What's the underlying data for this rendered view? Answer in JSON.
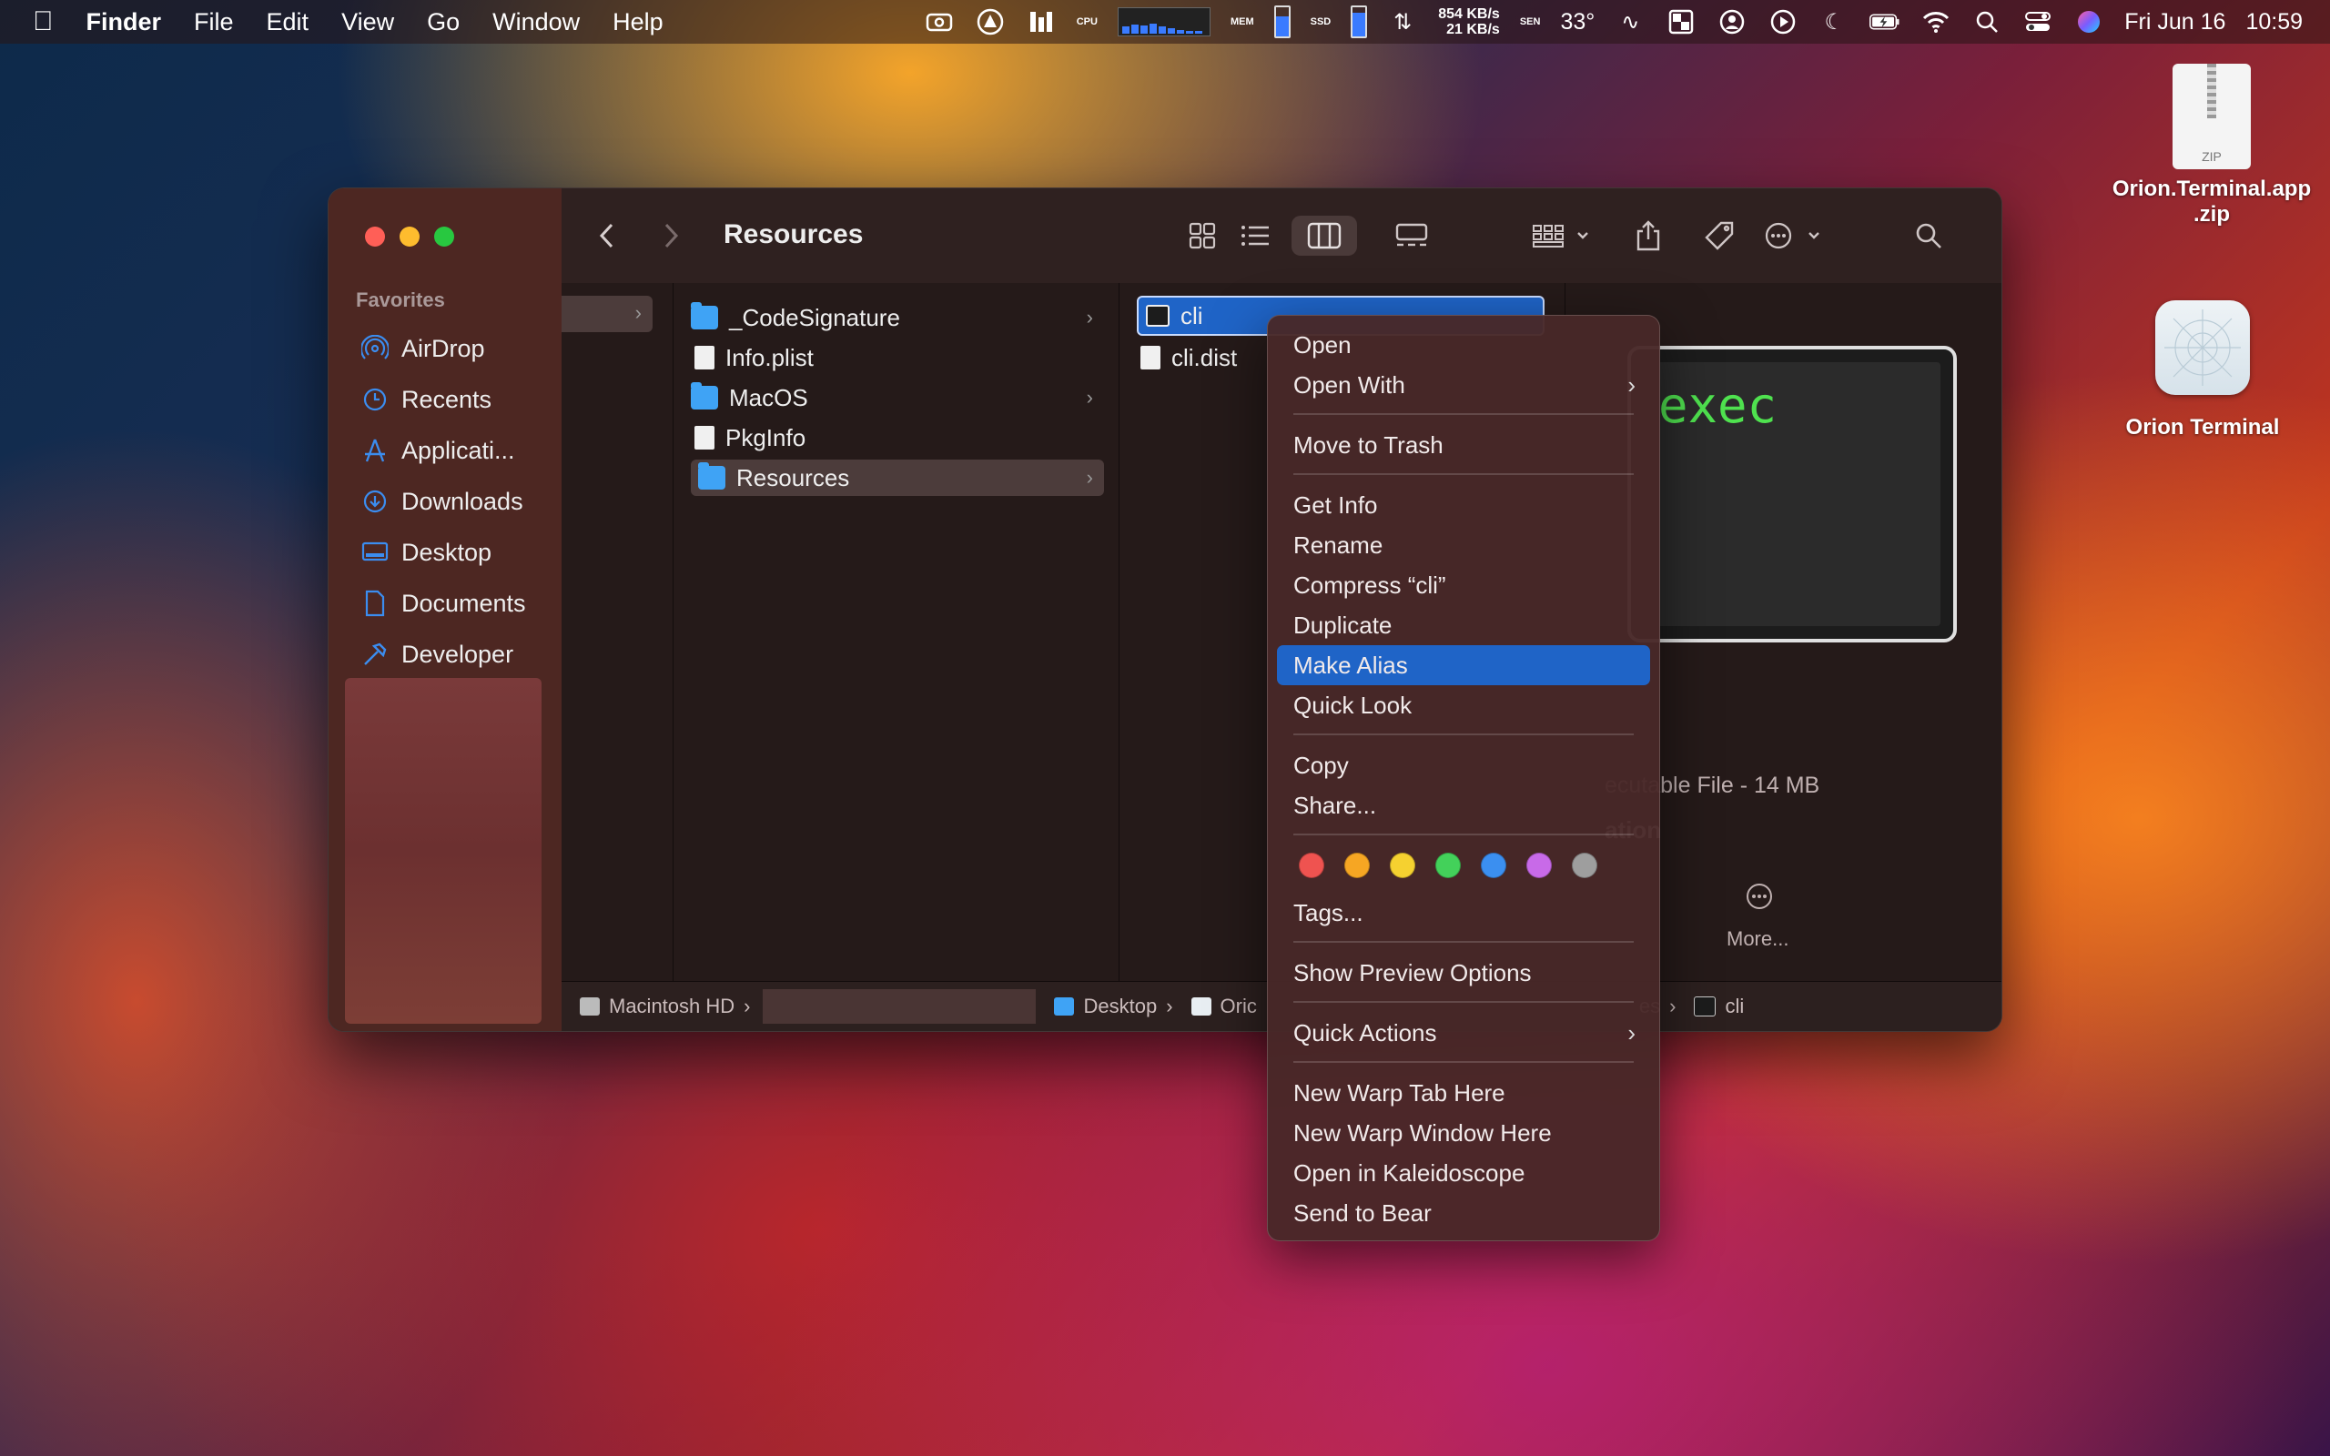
{
  "menubar": {
    "apple": "",
    "app": "Finder",
    "items": [
      "File",
      "Edit",
      "View",
      "Go",
      "Window",
      "Help"
    ],
    "net_up": "854 KB/s",
    "net_down": "21 KB/s",
    "temp": "33°",
    "cpu_label": "CPU",
    "mem_label": "MEM",
    "ssd_label": "SSD",
    "sen_label": "SEN",
    "date": "Fri Jun 16",
    "time": "10:59"
  },
  "sidebar": {
    "heading": "Favorites",
    "items": [
      {
        "label": "AirDrop",
        "icon": "airdrop-icon"
      },
      {
        "label": "Recents",
        "icon": "clock-icon"
      },
      {
        "label": "Applicati...",
        "icon": "applications-icon"
      },
      {
        "label": "Downloads",
        "icon": "download-icon"
      },
      {
        "label": "Desktop",
        "icon": "desktop-icon"
      },
      {
        "label": "Documents",
        "icon": "document-icon"
      },
      {
        "label": "Developer",
        "icon": "hammer-icon"
      }
    ]
  },
  "toolbar": {
    "title": "Resources"
  },
  "column2": [
    {
      "label": "_CodeSignature",
      "type": "folder",
      "chevron": true
    },
    {
      "label": "Info.plist",
      "type": "file",
      "chevron": false
    },
    {
      "label": "MacOS",
      "type": "folder",
      "chevron": true
    },
    {
      "label": "PkgInfo",
      "type": "file",
      "chevron": false
    },
    {
      "label": "Resources",
      "type": "folder",
      "chevron": true,
      "selected": true
    }
  ],
  "column3": [
    {
      "label": "cli",
      "type": "exec",
      "selected": true
    },
    {
      "label": "cli.dist",
      "type": "file"
    }
  ],
  "preview": {
    "screen_text": "exec",
    "kind": "ecutable File - 14 MB",
    "info": "ation",
    "more": "More..."
  },
  "pathbar": {
    "items": [
      "Macintosh HD",
      "Desktop",
      "Oric",
      "es",
      "cli"
    ]
  },
  "context_menu": {
    "open": "Open",
    "open_with": "Open With",
    "move_to_trash": "Move to Trash",
    "get_info": "Get Info",
    "rename": "Rename",
    "compress": "Compress “cli”",
    "duplicate": "Duplicate",
    "make_alias": "Make Alias",
    "quick_look": "Quick Look",
    "copy": "Copy",
    "share": "Share...",
    "tags": "Tags...",
    "show_preview_options": "Show Preview Options",
    "quick_actions": "Quick Actions",
    "new_warp_tab": "New Warp Tab Here",
    "new_warp_window": "New Warp Window Here",
    "open_kaleidoscope": "Open in Kaleidoscope",
    "send_to_bear": "Send to Bear",
    "tag_colors": [
      "#ef5350",
      "#f6a623",
      "#f5d130",
      "#43d15a",
      "#3b8ff0",
      "#c86ae8",
      "#9e9e9e"
    ]
  },
  "desktop": {
    "zip_label_1": "Orion.Terminal.app",
    "zip_label_2": ".zip",
    "zip_badge": "ZIP",
    "app_label": "Orion Terminal"
  }
}
